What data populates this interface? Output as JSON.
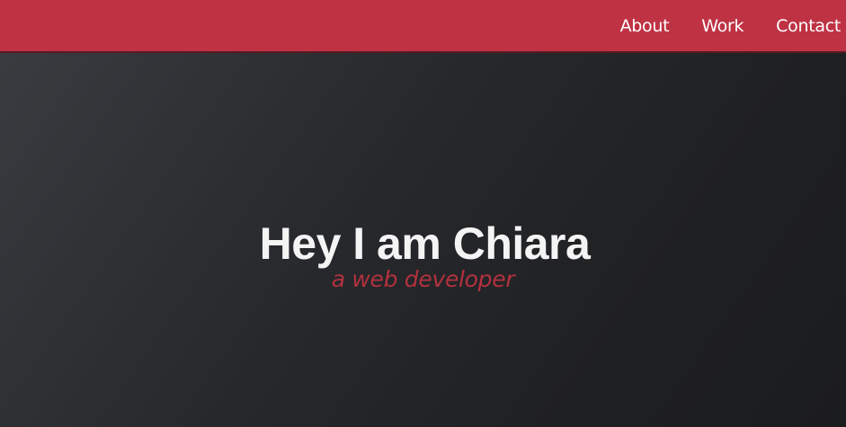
{
  "navbar": {
    "links": [
      {
        "label": "About"
      },
      {
        "label": "Work"
      },
      {
        "label": "Contact"
      }
    ],
    "background_color": "#bf3244"
  },
  "hero": {
    "title": "Hey I am Chiara",
    "subtitle": "a web developer",
    "title_color": "#f4f4f4",
    "subtitle_color": "#b3313f"
  }
}
